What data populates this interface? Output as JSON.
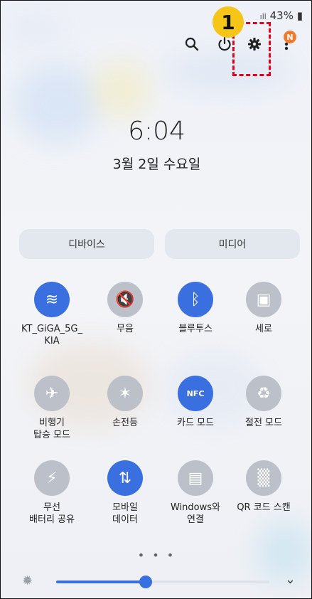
{
  "status": {
    "battery": "43%",
    "signal": "┃┃┃"
  },
  "header": {
    "search_icon": "search-icon",
    "power_icon": "power-icon",
    "settings_icon": "gear-icon",
    "more_icon": "more-vert-icon",
    "notification_badge": "N",
    "step_marker": "1"
  },
  "lockscreen": {
    "time": "6:04",
    "date": "3월 2일 수요일"
  },
  "pills": {
    "device": "디바이스",
    "media": "미디어"
  },
  "tiles": [
    {
      "label": "KT_GiGA_5G_\nKIA",
      "icon": "wifi-icon",
      "glyph": "≋",
      "active": true
    },
    {
      "label": "무음",
      "icon": "mute-icon",
      "glyph": "🔇",
      "active": false
    },
    {
      "label": "블루투스",
      "icon": "bluetooth-icon",
      "glyph": "ᛒ",
      "active": true
    },
    {
      "label": "세로",
      "icon": "portrait-lock-icon",
      "glyph": "▣",
      "active": false
    },
    {
      "label": "비행기\n탑승 모드",
      "icon": "airplane-icon",
      "glyph": "✈",
      "active": false
    },
    {
      "label": "손전등",
      "icon": "flashlight-icon",
      "glyph": "✶",
      "active": false
    },
    {
      "label": "카드 모드",
      "icon": "nfc-icon",
      "glyph": "NFC",
      "active": true
    },
    {
      "label": "절전 모드",
      "icon": "power-saving-icon",
      "glyph": "♻",
      "active": false
    },
    {
      "label": "무선\n배터리 공유",
      "icon": "wireless-battery-icon",
      "glyph": "⚡",
      "active": false
    },
    {
      "label": "모바일\n데이터",
      "icon": "mobile-data-icon",
      "glyph": "⇅",
      "active": true
    },
    {
      "label": "Windows와\n연결",
      "icon": "link-to-windows-icon",
      "glyph": "▤",
      "active": false
    },
    {
      "label": "QR 코드 스캔",
      "icon": "qr-icon",
      "glyph": "▒",
      "active": false
    }
  ],
  "pager": "• • •",
  "brightness": {
    "level": 0.42,
    "icon": "brightness-icon",
    "expand_icon": "chevron-down-icon"
  }
}
